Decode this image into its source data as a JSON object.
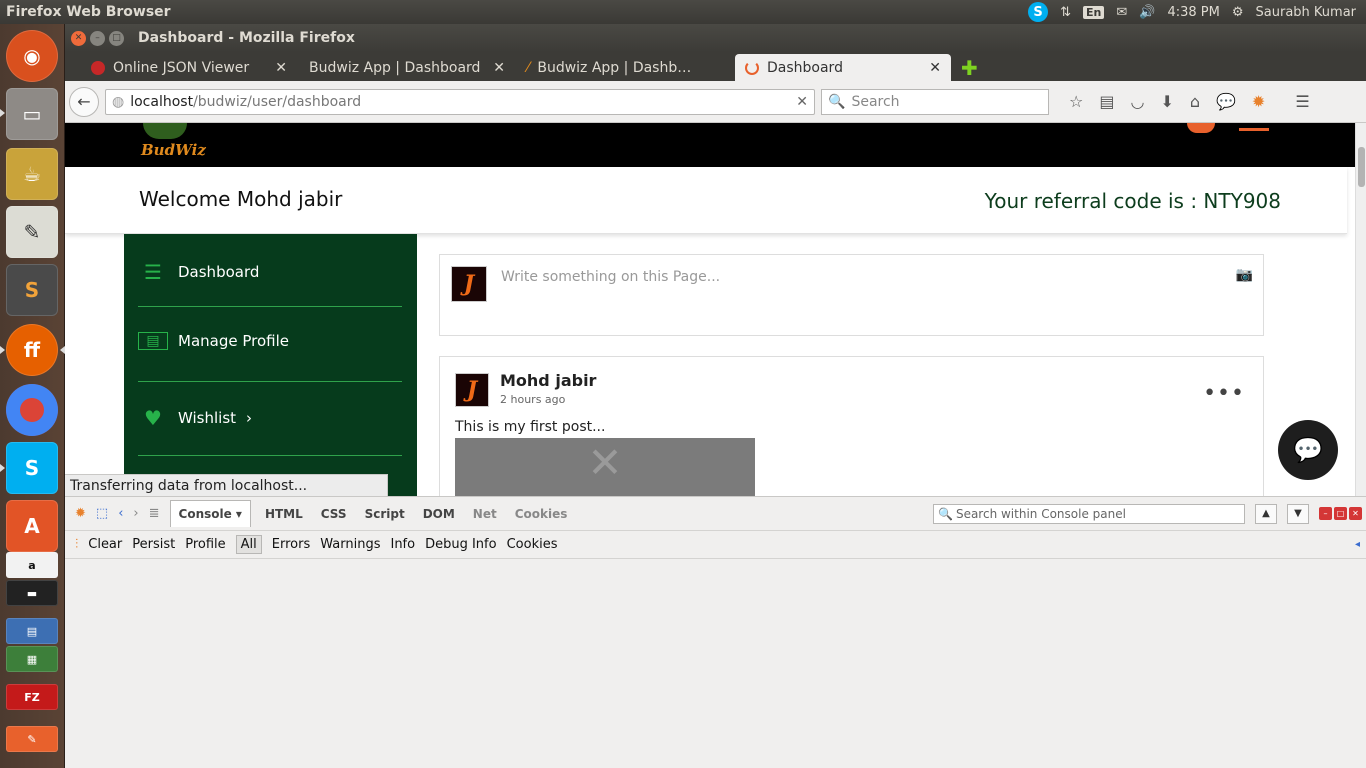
{
  "topbar": {
    "app_title": "Firefox Web Browser",
    "keyboard": "En",
    "time": "4:38 PM",
    "user": "Saurabh Kumar"
  },
  "window": {
    "title": "Dashboard - Mozilla Firefox"
  },
  "tabs": [
    {
      "label": "Online JSON Viewer",
      "favicon_color": "#c62828",
      "active": false
    },
    {
      "label": "Budwiz App | Dashboard",
      "favicon_color": "#dddddd",
      "active": false
    },
    {
      "label": "Budwiz App | Dashb…",
      "favicon_color": "#e08a1e",
      "active": false
    },
    {
      "label": "Dashboard",
      "favicon_color": "#e8612c",
      "active": true
    }
  ],
  "navbar": {
    "url_host": "localhost",
    "url_path": "/budwiz/user/dashboard",
    "search_placeholder": "Search"
  },
  "site": {
    "logo": "BudWiz",
    "welcome": "Welcome Mohd jabir",
    "referral": "Your referral code is : NTY908",
    "sidebar": [
      {
        "label": "Dashboard",
        "icon": "list-icon"
      },
      {
        "label": "Manage Profile",
        "icon": "id-card-icon"
      },
      {
        "label": "Wishlist",
        "icon": "heart-icon"
      }
    ],
    "post_placeholder": "Write something on this Page...",
    "avatar_letter": "J",
    "feed": {
      "author": "Mohd jabir",
      "time": "2 hours ago",
      "text": "This is my first post..."
    }
  },
  "status_text": "Transferring data from localhost...",
  "devtools": {
    "tabs": [
      "Console",
      "HTML",
      "CSS",
      "Script",
      "DOM",
      "Net",
      "Cookies"
    ],
    "search_placeholder": "Search within Console panel",
    "toolbar": [
      "Clear",
      "Persist",
      "Profile",
      "All",
      "Errors",
      "Warnings",
      "Info",
      "Debug Info",
      "Cookies"
    ]
  },
  "colors": {
    "sidebar_bg": "#063b1c",
    "accent_green": "#27b24a",
    "referral": "#0d3d1d"
  }
}
